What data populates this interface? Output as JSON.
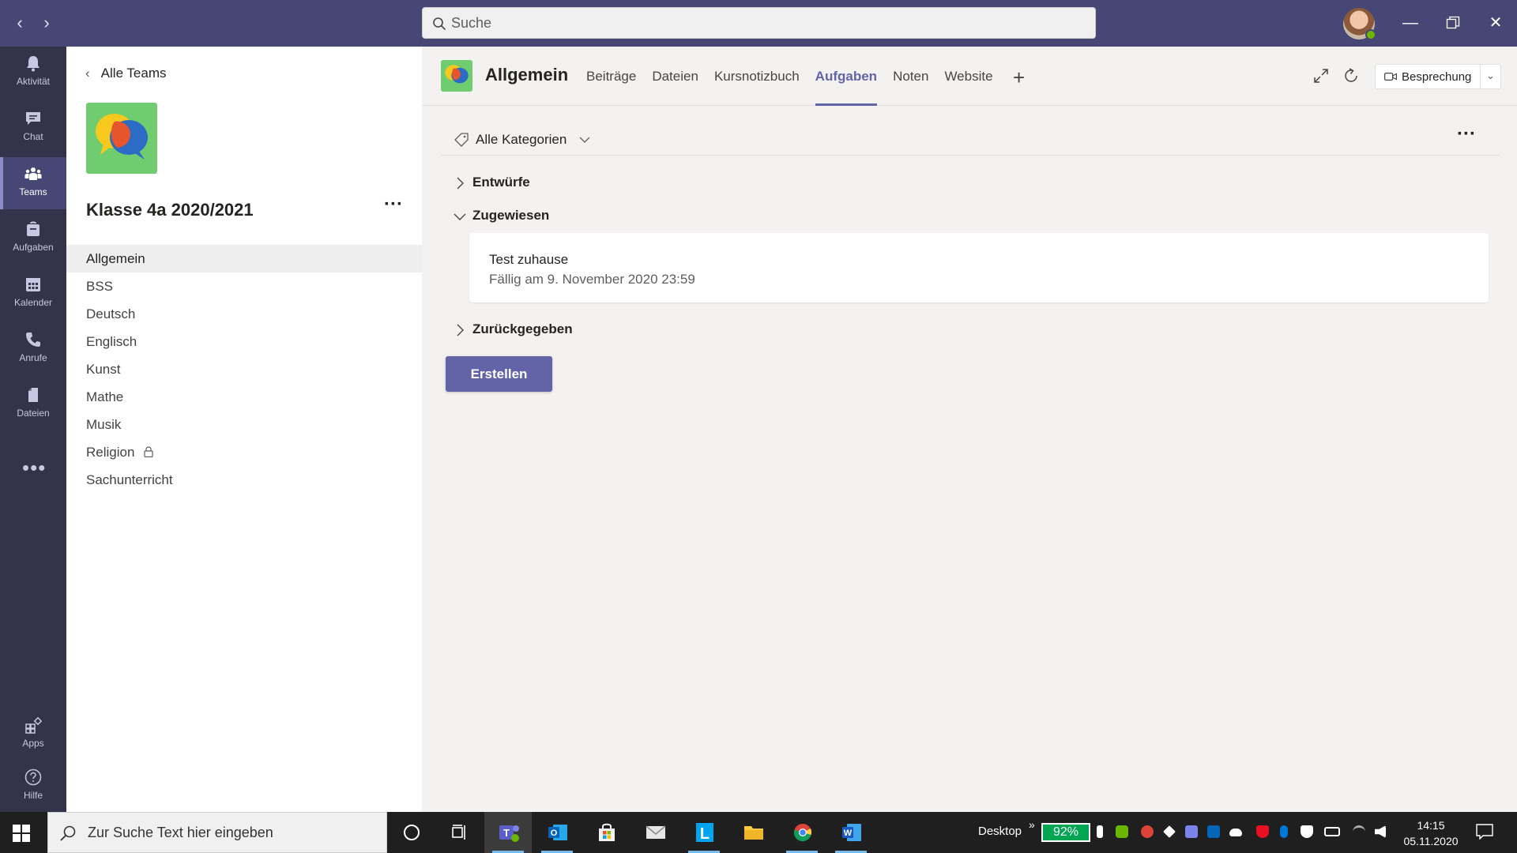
{
  "titlebar": {
    "search_placeholder": "Suche"
  },
  "rail": {
    "items": [
      {
        "label": "Aktivität",
        "icon": "bell-icon"
      },
      {
        "label": "Chat",
        "icon": "chat-icon"
      },
      {
        "label": "Teams",
        "icon": "teams-icon"
      },
      {
        "label": "Aufgaben",
        "icon": "assignments-icon"
      },
      {
        "label": "Kalender",
        "icon": "calendar-icon"
      },
      {
        "label": "Anrufe",
        "icon": "phone-icon"
      },
      {
        "label": "Dateien",
        "icon": "files-icon"
      }
    ],
    "active": "Teams",
    "apps_label": "Apps",
    "help_label": "Hilfe"
  },
  "left_pane": {
    "back_label": "Alle Teams",
    "team_name": "Klasse 4a 2020/2021",
    "channels": [
      {
        "name": "Allgemein",
        "active": true
      },
      {
        "name": "BSS"
      },
      {
        "name": "Deutsch"
      },
      {
        "name": "Englisch"
      },
      {
        "name": "Kunst"
      },
      {
        "name": "Mathe"
      },
      {
        "name": "Musik"
      },
      {
        "name": "Religion",
        "locked": true
      },
      {
        "name": "Sachunterricht"
      }
    ]
  },
  "main": {
    "channel_title": "Allgemein",
    "tabs": [
      {
        "label": "Beiträge"
      },
      {
        "label": "Dateien"
      },
      {
        "label": "Kursnotizbuch"
      },
      {
        "label": "Aufgaben",
        "active": true
      },
      {
        "label": "Noten"
      },
      {
        "label": "Website"
      }
    ],
    "meeting_button": "Besprechung",
    "filter_label": "Alle Kategorien",
    "sections": {
      "drafts": "Entwürfe",
      "assigned": "Zugewiesen",
      "returned": "Zurückgegeben"
    },
    "assignment": {
      "title": "Test zuhause",
      "due": "Fällig am 9. November 2020 23:59"
    },
    "create_button": "Erstellen"
  },
  "taskbar": {
    "search_placeholder": "Zur Suche Text hier eingeben",
    "desktop_label": "Desktop",
    "battery": "92%",
    "time": "14:15",
    "date": "05.11.2020"
  },
  "colors": {
    "titlebar": "#464775",
    "rail": "#33344a",
    "accent": "#6264a7",
    "team_logo_bg": "#6fcd6f",
    "battery_bg": "#00a651"
  }
}
